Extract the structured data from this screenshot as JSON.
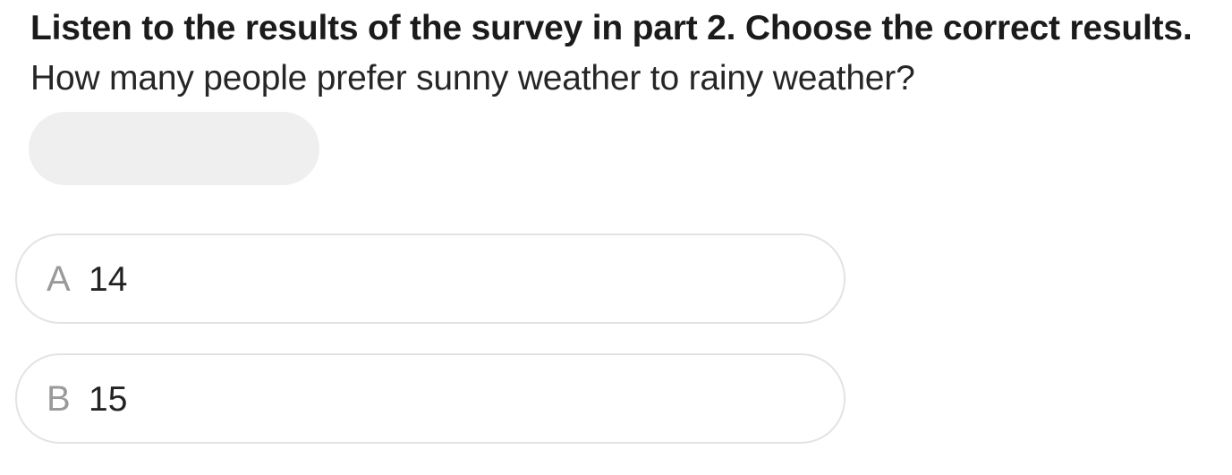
{
  "instruction": "Listen to the results of the survey in part 2. Choose the correct results.",
  "question": "How many people prefer sunny weather to rainy weather?",
  "audio": {
    "icon": "speaker-icon"
  },
  "options": [
    {
      "letter": "A",
      "text": "14"
    },
    {
      "letter": "B",
      "text": "15"
    }
  ],
  "colors": {
    "option_border": "#e3e3e3",
    "audio_bg": "#efefef",
    "letter": "#9a9a9a"
  }
}
